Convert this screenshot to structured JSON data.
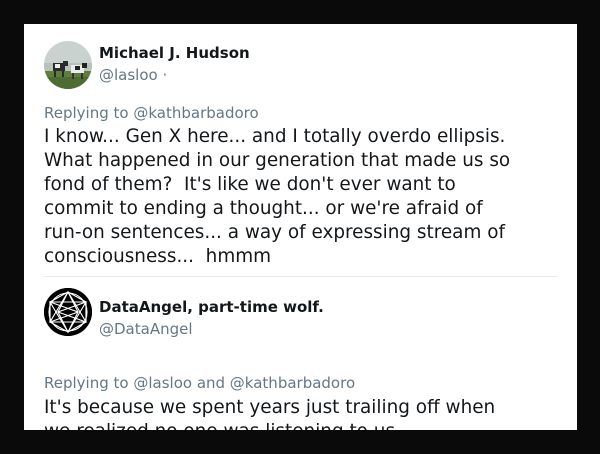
{
  "tweets": [
    {
      "author_name": "Michael J. Hudson",
      "handle": "@lasloo ·",
      "replying_prefix": "Replying to",
      "replying_mentions": "@kathbarbadoro",
      "text": "I know... Gen X here... and I totally overdo ellipsis.\nWhat happened in our generation that made us so\nfond of them?  It's like we don't ever want to\ncommit to ending a thought... or we're afraid of\nrun-on sentences... a way of expressing stream of\nconsciousness...  hmmm",
      "avatar_icon": "cows-field-photo-avatar"
    },
    {
      "author_name": "DataAngel, part-time wolf.",
      "handle": "@DataAngel",
      "replying_prefix": "Replying to",
      "replying_mentions": "@lasloo and @kathbarbadoro",
      "text": "It's because we spent years just trailing off when\nwe realized no one was listening to us.",
      "avatar_icon": "geometric-star-avatar"
    }
  ],
  "colors": {
    "frame": "#0a0a0a",
    "card": "#ffffff",
    "primary_text": "#14171a",
    "secondary_text": "#657786",
    "divider": "#e6ecf0"
  }
}
